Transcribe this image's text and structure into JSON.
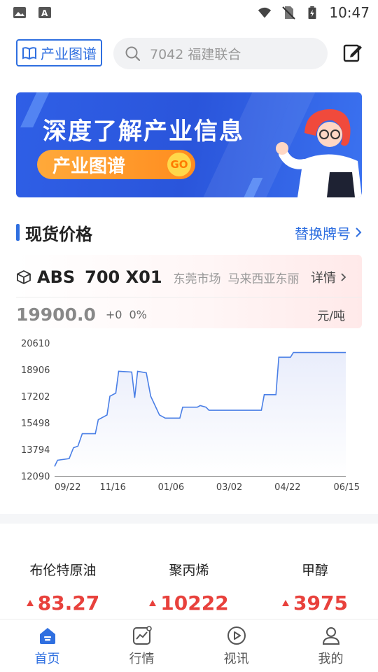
{
  "status_bar": {
    "time": "10:47"
  },
  "header": {
    "brand_label": "产业图谱",
    "search_placeholder": "7042 福建联合"
  },
  "banner": {
    "headline": "深度了解产业信息",
    "pill_text": "产业图谱",
    "go_text": "GO"
  },
  "section": {
    "title": "现货价格",
    "switch_label": "替换牌号"
  },
  "product": {
    "name": "ABS",
    "model": "700 X01",
    "market": "东莞市场",
    "origin": "马来西亚东丽",
    "detail_label": "详情",
    "price": "19900.0",
    "change": "+0",
    "change_pct": "0%",
    "unit": "元/吨"
  },
  "chart_data": {
    "type": "area",
    "x_ticks": [
      "09/22",
      "11/16",
      "01/06",
      "03/02",
      "04/22",
      "06/15"
    ],
    "y_ticks": [
      "20610",
      "18906",
      "17202",
      "15498",
      "13794",
      "12090"
    ],
    "ylim": [
      12090,
      20610
    ],
    "series": [
      {
        "values": [
          [
            0.0,
            12700
          ],
          [
            0.01,
            13100
          ],
          [
            0.05,
            13200
          ],
          [
            0.065,
            13900
          ],
          [
            0.08,
            14000
          ],
          [
            0.095,
            14800
          ],
          [
            0.14,
            14800
          ],
          [
            0.15,
            15700
          ],
          [
            0.18,
            16000
          ],
          [
            0.19,
            17200
          ],
          [
            0.21,
            17400
          ],
          [
            0.22,
            18800
          ],
          [
            0.265,
            18750
          ],
          [
            0.275,
            17100
          ],
          [
            0.285,
            18800
          ],
          [
            0.315,
            18700
          ],
          [
            0.33,
            17200
          ],
          [
            0.36,
            16000
          ],
          [
            0.38,
            15800
          ],
          [
            0.43,
            15800
          ],
          [
            0.44,
            16500
          ],
          [
            0.49,
            16500
          ],
          [
            0.5,
            16600
          ],
          [
            0.52,
            16500
          ],
          [
            0.53,
            16300
          ],
          [
            0.71,
            16300
          ],
          [
            0.72,
            17300
          ],
          [
            0.76,
            17300
          ],
          [
            0.77,
            19700
          ],
          [
            0.81,
            19700
          ],
          [
            0.82,
            20000
          ],
          [
            1.0,
            20000
          ]
        ]
      }
    ],
    "line_color": "#4a7fe6",
    "fill_color": "#e9edfb"
  },
  "commodities": [
    {
      "name": "布伦特原油",
      "value": "83.27"
    },
    {
      "name": "聚丙烯",
      "value": "10222"
    },
    {
      "name": "甲醇",
      "value": "3975"
    }
  ],
  "tabs": [
    {
      "label": "首页",
      "icon": "home-icon",
      "active": true
    },
    {
      "label": "行情",
      "icon": "market-chart-icon",
      "active": false
    },
    {
      "label": "视讯",
      "icon": "video-play-icon",
      "active": false
    },
    {
      "label": "我的",
      "icon": "user-icon",
      "active": false
    }
  ]
}
